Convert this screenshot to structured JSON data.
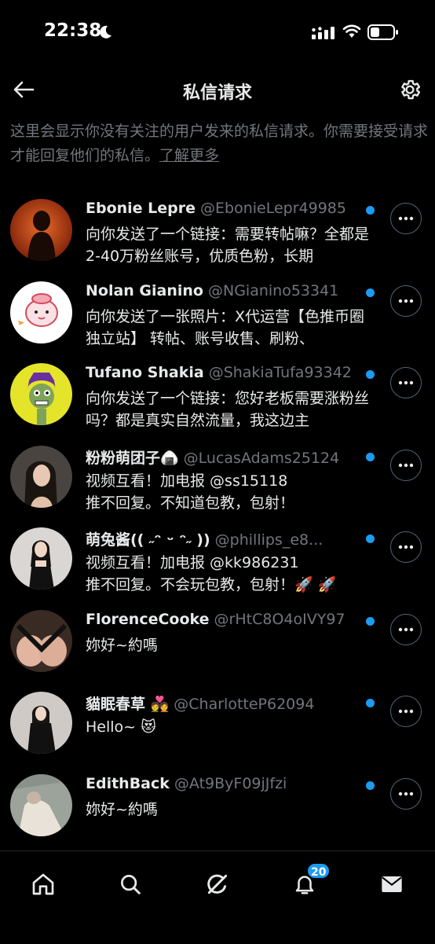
{
  "status_bar": {
    "time": "22:38"
  },
  "header": {
    "title": "私信请求"
  },
  "intro": {
    "text": "这里会显示你没有关注的用户发来的私信请求。你需要接受请求才能回复他们的私信。",
    "link": "了解更多"
  },
  "requests": [
    {
      "name": "Ebonie Lepre",
      "handle": "@EbonieLepr49985",
      "message": "向你发送了一个链接：需要转帖嘛？全都是2-40万粉丝账号，优质色粉，长期",
      "unread": true
    },
    {
      "name": "Nolan Gianino",
      "handle": "@NGianino53341",
      "message": "向你发送了一张照片：X代运营【色推币圈 独立站】 转帖、账号收售、刷粉、",
      "unread": true
    },
    {
      "name": "Tufano Shakia",
      "handle": "@ShakiaTufa93342",
      "message": "向你发送了一个链接：您好老板需要涨粉丝吗？都是真实自然流量，我这边主",
      "unread": true
    },
    {
      "name": "粉粉萌团子🍙",
      "handle": "@LucasAdams25124",
      "message": "视频互看！加电报 @ss15118\n推不回复。不知道包教，包射！",
      "unread": true
    },
    {
      "name": "萌兔酱(( ˶ᵔ ᵕ ᵔ˶ ))",
      "handle": "@phillips_e8...",
      "message": "视频互看！加电报 @kk986231\n推不回复。不会玩包教，包射！🚀 🚀",
      "unread": true
    },
    {
      "name": "FlorenceCooke",
      "handle": "@rHtC8O4oIVY97",
      "message": "妳好~約嗎",
      "unread": true
    },
    {
      "name": "貓眠春草 💑",
      "handle": "@CharlotteP62094",
      "message": "Hello~ 😻",
      "unread": true
    },
    {
      "name": "EdithBack",
      "handle": "@At9ByF09jJfzi",
      "message": "妳好~約嗎",
      "unread": true
    }
  ],
  "bottom_nav": {
    "items": [
      "home-icon",
      "search-icon",
      "grok-icon",
      "notifications-icon",
      "messages-icon"
    ],
    "notification_count": "20"
  },
  "colors": {
    "accent": "#1d9bf0",
    "background": "#000000",
    "secondary_text": "#71767b"
  }
}
